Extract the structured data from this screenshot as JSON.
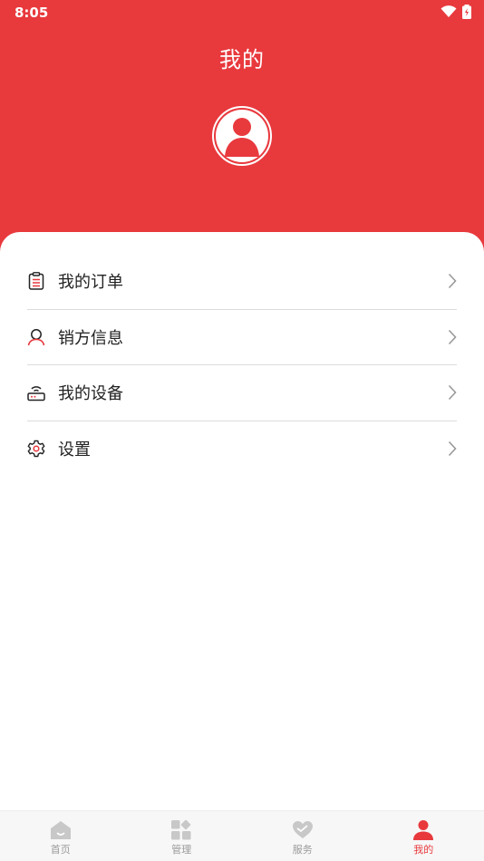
{
  "status_bar": {
    "time": "8:05"
  },
  "header": {
    "title": "我的"
  },
  "menu": {
    "items": [
      {
        "label": "我的订单",
        "icon": "clipboard-icon"
      },
      {
        "label": "销方信息",
        "icon": "user-icon"
      },
      {
        "label": "我的设备",
        "icon": "router-icon"
      },
      {
        "label": "设置",
        "icon": "gear-icon"
      }
    ]
  },
  "tabbar": {
    "tabs": [
      {
        "label": "首页",
        "icon": "home-icon",
        "active": false
      },
      {
        "label": "管理",
        "icon": "grid-icon",
        "active": false
      },
      {
        "label": "服务",
        "icon": "heart-icon",
        "active": false
      },
      {
        "label": "我的",
        "icon": "person-icon",
        "active": true
      }
    ]
  },
  "colors": {
    "accent": "#e8393d",
    "inactive": "#c8c8c8",
    "divider": "#dcdcdc"
  }
}
